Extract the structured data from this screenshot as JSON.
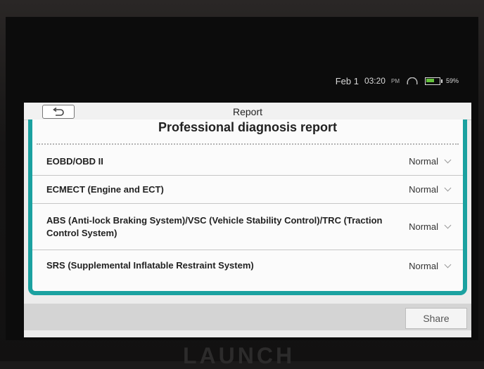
{
  "status_bar": {
    "date": "Feb 1",
    "time": "03:20",
    "ampm": "PM",
    "battery": "59%",
    "battery_level": 0.59,
    "icons": [
      "wifi-icon",
      "battery-icon"
    ]
  },
  "header": {
    "title": "Report",
    "back_icon": "back-arrow-icon"
  },
  "report": {
    "heading": "Professional diagnosis report",
    "rows": [
      {
        "label": "EOBD/OBD II",
        "status": "Normal"
      },
      {
        "label": "ECMECT (Engine and ECT)",
        "status": "Normal"
      },
      {
        "label": "ABS (Anti-lock Braking System)/VSC (Vehicle Stability Control)/TRC (Traction Control System)",
        "status": "Normal"
      },
      {
        "label": "SRS (Supplemental Inflatable Restraint System)",
        "status": "Normal"
      }
    ]
  },
  "footer": {
    "share_label": "Share"
  },
  "device": {
    "brand": "LAUNCH"
  },
  "colors": {
    "accent": "#1ba1a0",
    "battery": "#63c13a"
  }
}
